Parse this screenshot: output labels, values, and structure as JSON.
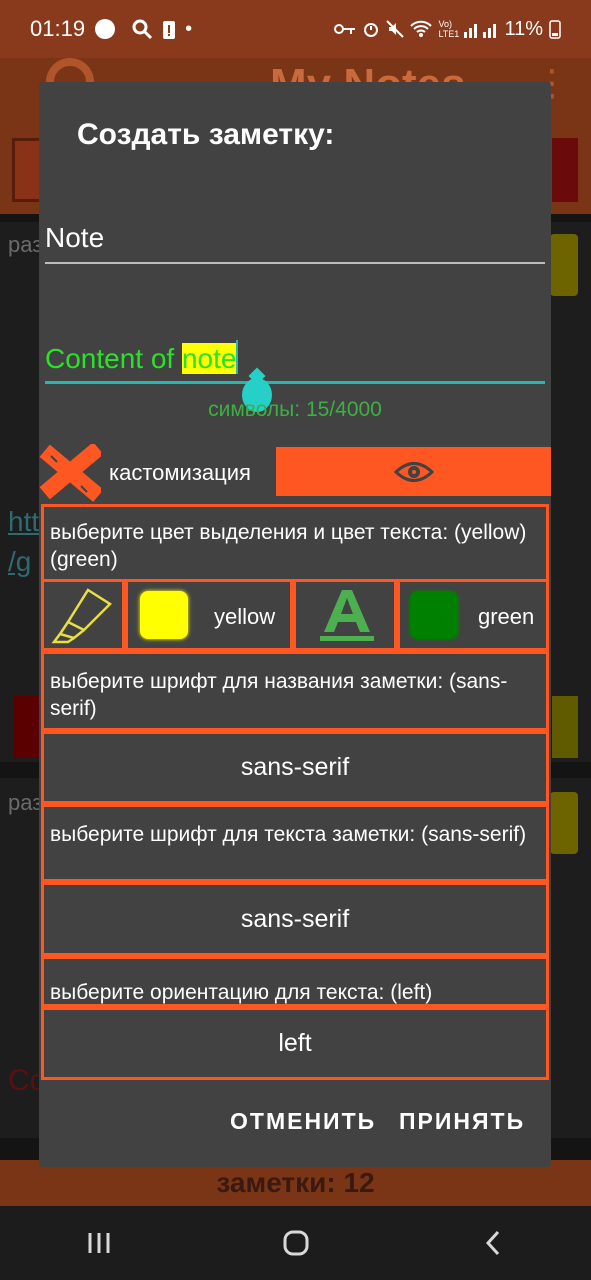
{
  "status_bar": {
    "time": "01:19",
    "network_label": "Vo) LTE1",
    "battery": "11%"
  },
  "background_app": {
    "title": "My Notes",
    "snippets": {
      "card1_prefix": "раз",
      "link1": "htt",
      "link2": "/g",
      "card2_prefix": "раз",
      "red_prefix": "Co"
    },
    "notes_count_label": "заметки: 12"
  },
  "dialog": {
    "title": "Создать заметку:",
    "note_title_value": "Note",
    "note_content": {
      "prefix": "Content of ",
      "highlighted": "note"
    },
    "char_counter": "символы: 15/4000",
    "customization_label": "кастомизация",
    "colors_prompt": "выберите цвет выделения и цвет текста: (yellow) (green)",
    "highlight_color": {
      "name": "yellow",
      "hex": "#ffff00"
    },
    "text_color": {
      "name": "green",
      "hex": "#008000"
    },
    "title_font_prompt": "выберите шрифт для названия заметки: (sans-serif)",
    "title_font_value": "sans-serif",
    "text_font_prompt": "выберите шрифт для текста заметки: (sans-serif)",
    "text_font_value": "sans-serif",
    "orientation_prompt": "выберите ориентацию для текста: (left)",
    "orientation_value": "left",
    "cancel_label": "ОТМЕНИТЬ",
    "accept_label": "ПРИНЯТЬ"
  },
  "nav_bar": {
    "recents_icon": "recents-icon",
    "home_icon": "home-icon",
    "back_icon": "back-icon"
  },
  "colors": {
    "accent": "#ff5722",
    "dialog_bg": "#424242",
    "counter_green": "#3cb043",
    "input_underline": "#26b8b0"
  }
}
